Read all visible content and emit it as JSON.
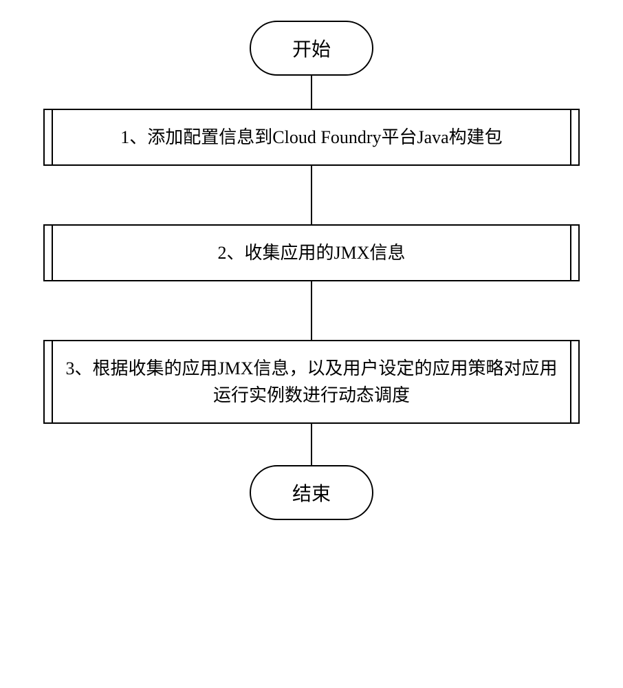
{
  "flowchart": {
    "start": "开始",
    "step1": "1、添加配置信息到Cloud Foundry平台Java构建包",
    "step2": "2、收集应用的JMX信息",
    "step3": "3、根据收集的应用JMX信息，以及用户设定的应用策略对应用运行实例数进行动态调度",
    "end": "结束"
  }
}
